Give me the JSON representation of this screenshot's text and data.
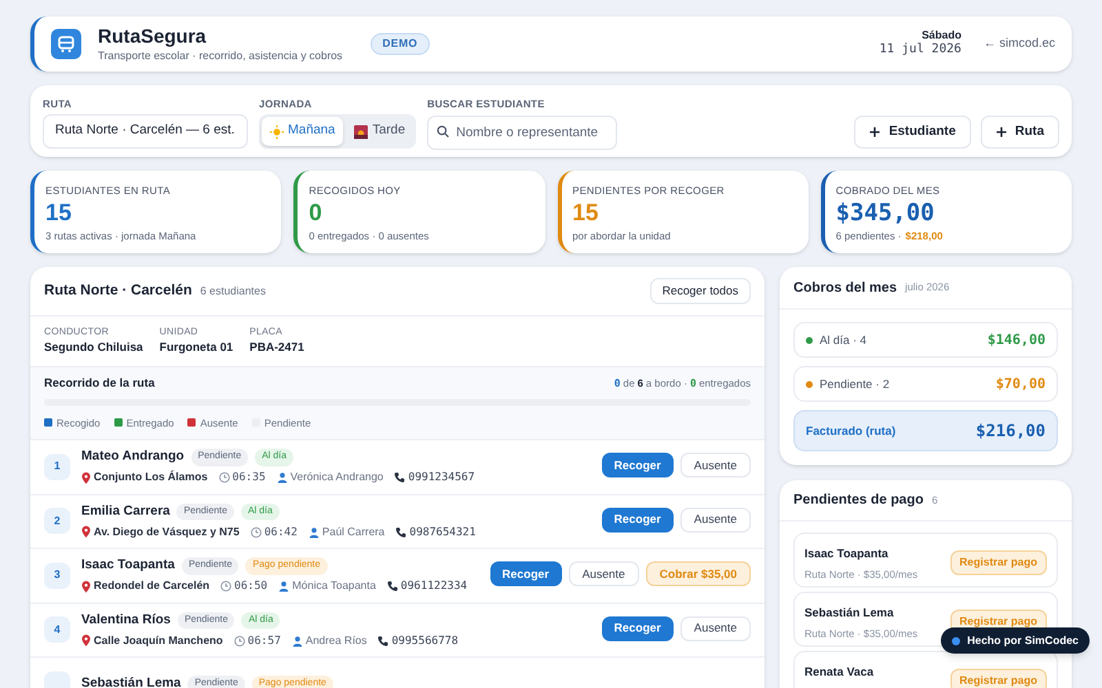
{
  "header": {
    "title": "RutaSegura",
    "subtitle": "Transporte escolar · recorrido, asistencia y cobros",
    "badge": "DEMO",
    "day": "Sábado",
    "date": "11 jul 2026",
    "link": "← simcod.ec"
  },
  "filters": {
    "route_label": "RUTA",
    "route_value": "Ruta Norte · Carcelén — 6 est.",
    "shift_label": "JORNADA",
    "shifts": [
      {
        "label": "Mañana",
        "kind": "sun",
        "selected": true
      },
      {
        "label": "Tarde",
        "kind": "sunset",
        "selected": false
      }
    ],
    "search_label": "BUSCAR ESTUDIANTE",
    "search_placeholder": "Nombre o representante",
    "buttons": [
      "Estudiante",
      "Ruta"
    ]
  },
  "stats": [
    {
      "label": "ESTUDIANTES EN RUTA",
      "value": "15",
      "note": "3 rutas activas · jornada Mañana",
      "color": "#1f6fc5"
    },
    {
      "label": "RECOGIDOS HOY",
      "value": "0",
      "note": "0 entregados · 0 ausentes",
      "color": "#2e9a47"
    },
    {
      "label": "PENDIENTES POR RECOGER",
      "value": "15",
      "note": "por abordar la unidad",
      "color": "#e08a12"
    },
    {
      "label": "COBRADO DEL MES",
      "value": "$345,00",
      "note": "6 pendientes ·",
      "note_extra": "$218,00",
      "color": "#1a5fb0"
    }
  ],
  "route": {
    "title": "Ruta Norte · Carcelén",
    "count": "6 estudiantes",
    "action": "Recoger todos",
    "info": [
      {
        "label": "CONDUCTOR",
        "value": "Segundo Chiluisa"
      },
      {
        "label": "UNIDAD",
        "value": "Furgoneta 01"
      },
      {
        "label": "PLACA",
        "value": "PBA-2471"
      }
    ],
    "progress": {
      "title": "Recorrido de la ruta",
      "onboard": "0",
      "of": "de",
      "total": "6",
      "onboard_label": "a bordo ·",
      "delivered": "0",
      "delivered_label": "entregados",
      "level": 0
    },
    "legend": [
      {
        "label": "Recogido",
        "color": "#1f6fc5"
      },
      {
        "label": "Entregado",
        "color": "#2e9a47"
      },
      {
        "label": "Ausente",
        "color": "#d0323a"
      },
      {
        "label": "Pendiente",
        "color": "#eceef2"
      }
    ],
    "students": [
      {
        "number": "1",
        "name": "Mateo Andrango",
        "status": "Pendiente",
        "payment": {
          "label": "Al día",
          "kind": "ok"
        },
        "address": "Conjunto Los Álamos",
        "time": "06:35",
        "guardian": "Verónica Andrango",
        "phone": "0991234567",
        "actions": [
          {
            "label": "Recoger",
            "kind": "primary"
          },
          {
            "label": "Ausente",
            "kind": "secondary"
          }
        ]
      },
      {
        "number": "2",
        "name": "Emilia Carrera",
        "status": "Pendiente",
        "payment": {
          "label": "Al día",
          "kind": "ok"
        },
        "address": "Av. Diego de Vásquez y N75",
        "time": "06:42",
        "guardian": "Paúl Carrera",
        "phone": "0987654321",
        "actions": [
          {
            "label": "Recoger",
            "kind": "primary"
          },
          {
            "label": "Ausente",
            "kind": "secondary"
          }
        ]
      },
      {
        "number": "3",
        "name": "Isaac Toapanta",
        "status": "Pendiente",
        "payment": {
          "label": "Pago pendiente",
          "kind": "due"
        },
        "address": "Redondel de Carcelén",
        "time": "06:50",
        "guardian": "Mónica Toapanta",
        "phone": "0961122334",
        "actions": [
          {
            "label": "Recoger",
            "kind": "primary"
          },
          {
            "label": "Ausente",
            "kind": "secondary"
          },
          {
            "label": "Cobrar $35,00",
            "kind": "charge"
          }
        ]
      },
      {
        "number": "4",
        "name": "Valentina Ríos",
        "status": "Pendiente",
        "payment": {
          "label": "Al día",
          "kind": "ok"
        },
        "address": "Calle Joaquín Mancheno",
        "time": "06:57",
        "guardian": "Andrea Ríos",
        "phone": "0995566778",
        "actions": [
          {
            "label": "Recoger",
            "kind": "primary"
          },
          {
            "label": "Ausente",
            "kind": "secondary"
          }
        ]
      },
      {
        "name": "Sebastián Lema",
        "status": "Pendiente",
        "payment": {
          "label": "Pago pendiente",
          "kind": "due"
        }
      }
    ]
  },
  "billing": {
    "title": "Cobros del mes",
    "period": "julio 2026",
    "rows": [
      {
        "label": "Al día · 4",
        "amount": "$146,00",
        "color": "#2e9a47"
      },
      {
        "label": "Pendiente · 2",
        "amount": "$70,00",
        "color": "#e08a12"
      }
    ],
    "total": {
      "label": "Facturado (ruta)",
      "amount": "$216,00"
    }
  },
  "pending": {
    "title": "Pendientes de pago",
    "count": "6",
    "items": [
      {
        "name": "Isaac Toapanta",
        "detail": "Ruta Norte · $35,00/mes",
        "action": "Registrar pago"
      },
      {
        "name": "Sebastián Lema",
        "detail": "Ruta Norte · $35,00/mes",
        "action": "Registrar pago"
      },
      {
        "name": "Renata Vaca",
        "action": "Registrar pago"
      }
    ]
  },
  "footer_badge": "Hecho por SimCodec"
}
